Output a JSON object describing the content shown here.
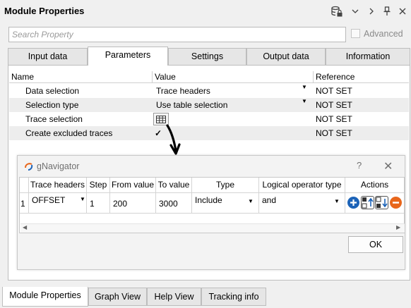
{
  "window": {
    "title": "Module Properties",
    "icons": [
      "database-lock-icon",
      "chevron-down-icon",
      "chevron-right-icon",
      "pin-icon",
      "close-icon"
    ]
  },
  "search": {
    "placeholder": "Search Property",
    "advanced_label": "Advanced",
    "advanced_checked": false
  },
  "tabs": [
    {
      "label": "Input data",
      "active": false
    },
    {
      "label": "Parameters",
      "active": true
    },
    {
      "label": "Settings",
      "active": false
    },
    {
      "label": "Output data",
      "active": false
    },
    {
      "label": "Information",
      "active": false
    }
  ],
  "properties": {
    "columns": [
      "Name",
      "Value",
      "Reference"
    ],
    "rows": [
      {
        "name": "Data selection",
        "value": "Trace headers",
        "reference": "NOT SET",
        "dropdown": true
      },
      {
        "name": "Selection type",
        "value": "Use table selection",
        "reference": "NOT SET",
        "dropdown": true
      },
      {
        "name": "Trace selection",
        "value": "",
        "reference": "NOT SET",
        "icon": "table-grid-icon"
      },
      {
        "name": "Create excluded traces",
        "value": "✓",
        "reference": "NOT SET",
        "icon": "checkmark-icon"
      }
    ]
  },
  "dialog": {
    "title": "gNavigator",
    "help": "?",
    "close": "✕",
    "columns": [
      "Trace headers",
      "Step",
      "From value",
      "To value",
      "Type",
      "Logical operator type",
      "Actions"
    ],
    "rows": [
      {
        "index": "1",
        "trace_header": "OFFSET",
        "step": "1",
        "from": "200",
        "to": "3000",
        "type": "Include",
        "logic": "and"
      }
    ],
    "action_icons": [
      "add-row-icon",
      "move-up-icon",
      "move-down-icon",
      "remove-row-icon"
    ],
    "ok_label": "OK"
  },
  "bottom_tabs": [
    {
      "label": "Module Properties",
      "active": true
    },
    {
      "label": "Graph View",
      "active": false
    },
    {
      "label": "Help View",
      "active": false
    },
    {
      "label": "Tracking info",
      "active": false
    }
  ],
  "colors": {
    "accent_blue": "#1c63b8",
    "remove_orange": "#e8661b",
    "row_alt": "#ededed"
  }
}
